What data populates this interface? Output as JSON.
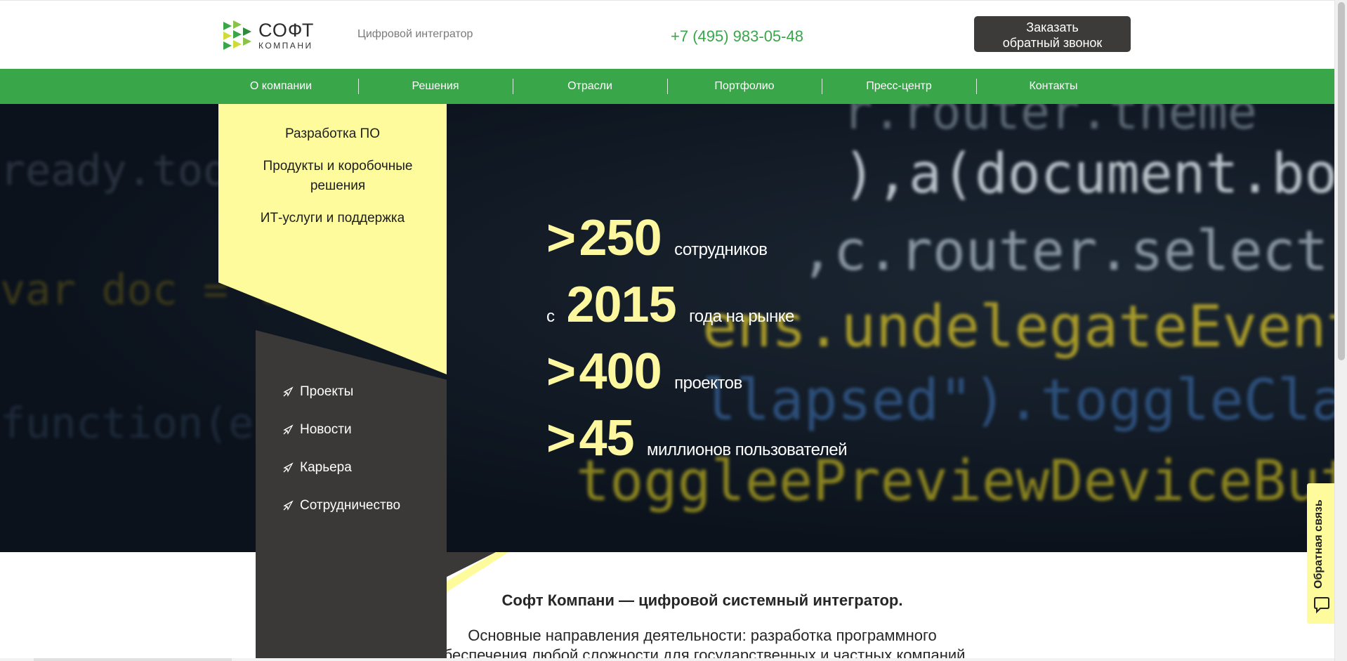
{
  "header": {
    "logo_title": "СОФТ",
    "logo_subtitle": "КОМПАНИ",
    "tagline": "Цифровой интегратор",
    "phone": "+7 (495) 983-05-48",
    "callback_label": "Заказать обратный звонок"
  },
  "nav": {
    "items": [
      {
        "label": "О компании"
      },
      {
        "label": "Решения"
      },
      {
        "label": "Отрасли"
      },
      {
        "label": "Портфолио"
      },
      {
        "label": "Пресс-центр"
      },
      {
        "label": "Контакты"
      }
    ]
  },
  "services": {
    "items": [
      {
        "label": "Разработка ПО"
      },
      {
        "label": "Продукты и коробочные решения"
      },
      {
        "label": "ИТ-услуги и поддержка"
      }
    ]
  },
  "side_menu": {
    "items": [
      {
        "label": "Проекты",
        "icon": "rocket-icon"
      },
      {
        "label": "Новости",
        "icon": "rocket-icon"
      },
      {
        "label": "Карьера",
        "icon": "rocket-icon"
      },
      {
        "label": "Сотрудничество",
        "icon": "rocket-icon"
      }
    ]
  },
  "stats": [
    {
      "prefix": ">",
      "value": "250",
      "label": "сотрудников"
    },
    {
      "prefix": "с",
      "value": "2015",
      "label": "года на рынке"
    },
    {
      "prefix": ">",
      "value": "400",
      "label": "проектов"
    },
    {
      "prefix": ">",
      "value": "45",
      "label": "миллионов пользователей"
    }
  ],
  "content": {
    "title": "Софт Компани — цифровой системный интегратор.",
    "text": "Основные направления деятельности: разработка программного обеспечения любой сложности для государственных и частных компаний, автоматизация и цифровизация"
  },
  "feedback_tab": {
    "label": "Обратная связь",
    "icon": "chat-icon"
  },
  "colors": {
    "accent_green": "#3aa64a",
    "accent_yellow": "#fdfb9c",
    "dark_panel": "#3b3938",
    "stat_number": "#fdf8a0",
    "button_bg": "#3d3b39"
  }
}
